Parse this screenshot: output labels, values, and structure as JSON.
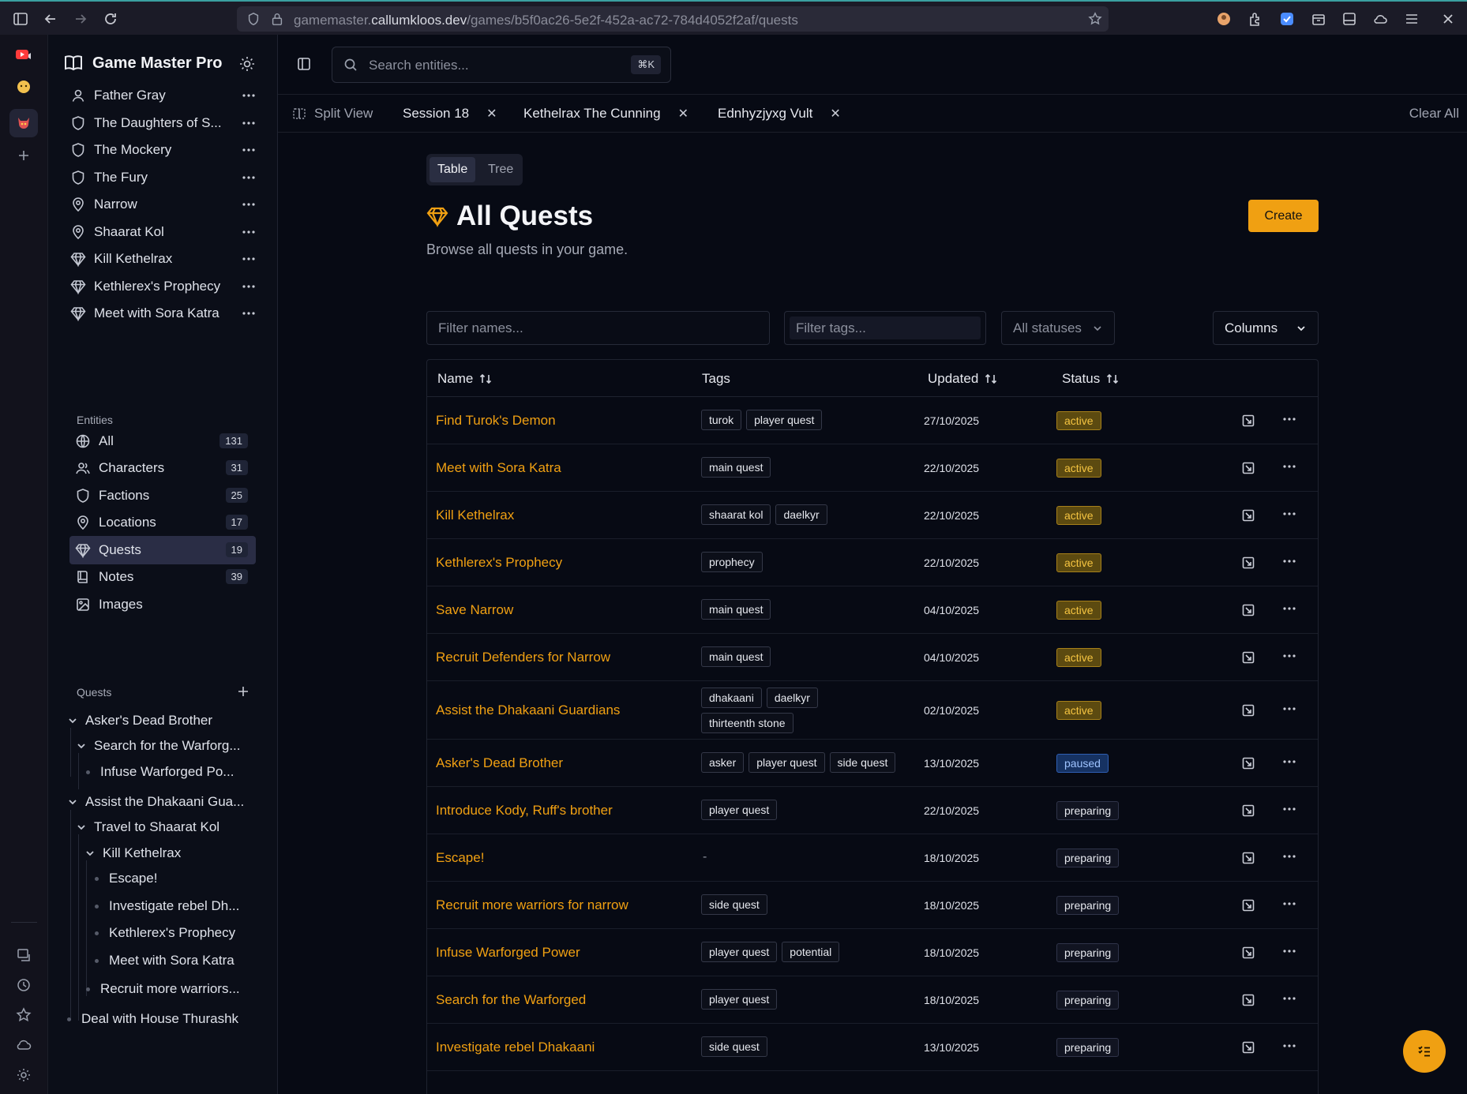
{
  "browser": {
    "url_prefix": "gamemaster.",
    "url_domain": "callumkloos.dev",
    "url_path": "/games/b5f0ac26-5e2f-452a-ac72-784d4052f2af/quests"
  },
  "app": {
    "name": "Game Master Pro",
    "search_placeholder": "Search entities...",
    "search_shortcut": "⌘K"
  },
  "recent": [
    {
      "label": "Father Gray",
      "icon": "user-icon"
    },
    {
      "label": "The Daughters of S...",
      "icon": "shield-icon"
    },
    {
      "label": "The Mockery",
      "icon": "shield-icon"
    },
    {
      "label": "The Fury",
      "icon": "shield-icon"
    },
    {
      "label": "Narrow",
      "icon": "map-pin-icon"
    },
    {
      "label": "Shaarat Kol",
      "icon": "map-pin-icon"
    },
    {
      "label": "Kill Kethelrax",
      "icon": "gem-icon"
    },
    {
      "label": "Kethlerex's Prophecy",
      "icon": "gem-icon"
    },
    {
      "label": "Meet with Sora Katra",
      "icon": "gem-icon"
    }
  ],
  "entities": {
    "heading": "Entities",
    "items": [
      {
        "label": "All",
        "count": "131",
        "icon": "globe-icon"
      },
      {
        "label": "Characters",
        "count": "31",
        "icon": "users-icon"
      },
      {
        "label": "Factions",
        "count": "25",
        "icon": "shield-icon"
      },
      {
        "label": "Locations",
        "count": "17",
        "icon": "map-pin-icon"
      },
      {
        "label": "Quests",
        "count": "19",
        "icon": "gem-icon"
      },
      {
        "label": "Notes",
        "count": "39",
        "icon": "notes-icon"
      },
      {
        "label": "Images",
        "count": "",
        "icon": "image-icon"
      }
    ]
  },
  "quest_tree": {
    "heading": "Quests",
    "items": [
      {
        "label": "Asker's Dead Brother"
      },
      {
        "label": "Search for the Warforg..."
      },
      {
        "label": "Infuse Warforged Po..."
      },
      {
        "label": "Assist the Dhakaani Gua..."
      },
      {
        "label": "Travel to Shaarat Kol"
      },
      {
        "label": "Kill Kethelrax"
      },
      {
        "label": "Escape!"
      },
      {
        "label": "Investigate rebel Dh..."
      },
      {
        "label": "Kethlerex's Prophecy"
      },
      {
        "label": "Meet with Sora Katra"
      },
      {
        "label": "Recruit more warriors..."
      },
      {
        "label": "Deal with House Thurashk"
      }
    ]
  },
  "tabs": {
    "split_view": "Split View",
    "open": [
      {
        "label": "Session 18"
      },
      {
        "label": "Kethelrax The Cunning"
      },
      {
        "label": "Ednhyzjyxg Vult"
      }
    ],
    "clear_all": "Clear All"
  },
  "view_toggle": {
    "table": "Table",
    "tree": "Tree"
  },
  "page": {
    "title": "All Quests",
    "subtitle": "Browse all quests in your game.",
    "create": "Create"
  },
  "filters": {
    "names_placeholder": "Filter names...",
    "tags_placeholder": "Filter tags...",
    "status": "All statuses",
    "columns": "Columns"
  },
  "table": {
    "columns": {
      "name": "Name",
      "tags": "Tags",
      "updated": "Updated",
      "status": "Status"
    },
    "rows": [
      {
        "name": "Find Turok's Demon",
        "tags": [
          "turok",
          "player quest"
        ],
        "updated": "27/10/2025",
        "status": "active"
      },
      {
        "name": "Meet with Sora Katra",
        "tags": [
          "main quest"
        ],
        "updated": "22/10/2025",
        "status": "active"
      },
      {
        "name": "Kill Kethelrax",
        "tags": [
          "shaarat kol",
          "daelkyr"
        ],
        "updated": "22/10/2025",
        "status": "active"
      },
      {
        "name": "Kethlerex's Prophecy",
        "tags": [
          "prophecy"
        ],
        "updated": "22/10/2025",
        "status": "active"
      },
      {
        "name": "Save Narrow",
        "tags": [
          "main quest"
        ],
        "updated": "04/10/2025",
        "status": "active"
      },
      {
        "name": "Recruit Defenders for Narrow",
        "tags": [
          "main quest"
        ],
        "updated": "04/10/2025",
        "status": "active"
      },
      {
        "name": "Assist the Dhakaani Guardians",
        "tags": [
          "dhakaani",
          "daelkyr",
          "thirteenth stone"
        ],
        "updated": "02/10/2025",
        "status": "active"
      },
      {
        "name": "Asker's Dead Brother",
        "tags": [
          "asker",
          "player quest",
          "side quest"
        ],
        "updated": "13/10/2025",
        "status": "paused"
      },
      {
        "name": "Introduce Kody, Ruff's brother",
        "tags": [
          "player quest"
        ],
        "updated": "22/10/2025",
        "status": "preparing"
      },
      {
        "name": "Escape!",
        "tags": [],
        "empty_tags": "-",
        "updated": "18/10/2025",
        "status": "preparing"
      },
      {
        "name": "Recruit more warriors for narrow",
        "tags": [
          "side quest"
        ],
        "updated": "18/10/2025",
        "status": "preparing"
      },
      {
        "name": "Infuse Warforged Power",
        "tags": [
          "player quest",
          "potential"
        ],
        "updated": "18/10/2025",
        "status": "preparing"
      },
      {
        "name": "Search for the Warforged",
        "tags": [
          "player quest"
        ],
        "updated": "18/10/2025",
        "status": "preparing"
      },
      {
        "name": "Investigate rebel Dhakaani",
        "tags": [
          "side quest"
        ],
        "updated": "13/10/2025",
        "status": "preparing"
      }
    ]
  },
  "colors": {
    "accent": "#f0a012",
    "background": "#070a14"
  }
}
